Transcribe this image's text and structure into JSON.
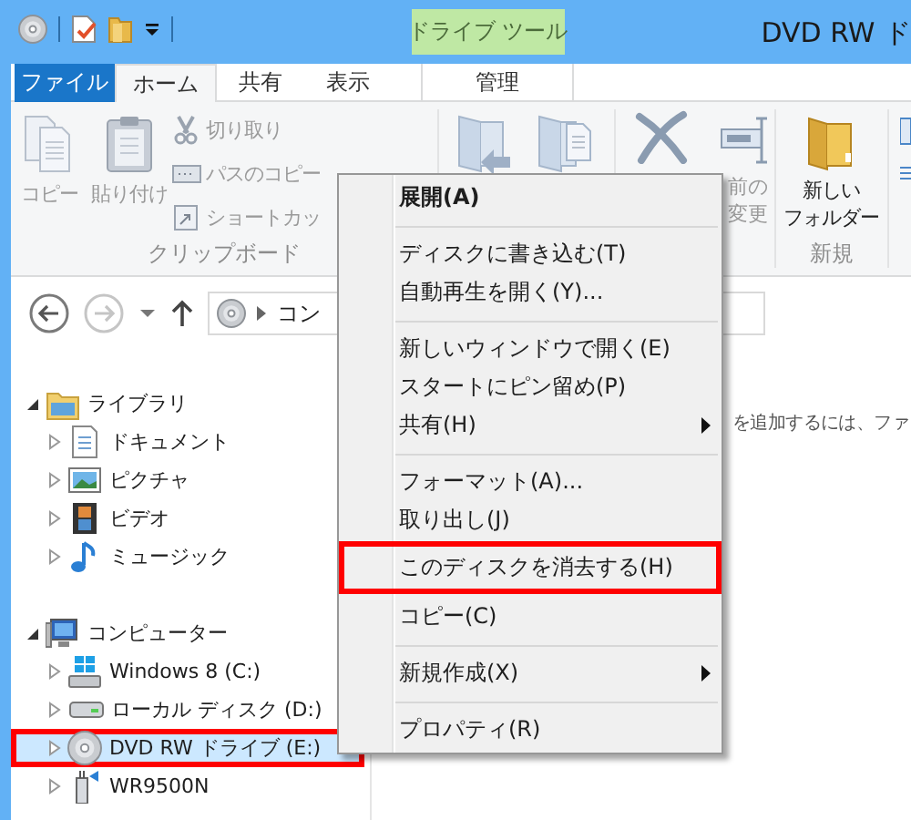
{
  "title_bar": {
    "contextual_tab": "ドライブ ツール",
    "title": "DVD RW ド"
  },
  "ribbon_tabs": [
    {
      "label": "ファイル",
      "kind": "file",
      "selected": false
    },
    {
      "label": "ホーム",
      "kind": "tab",
      "selected": true
    },
    {
      "label": "共有",
      "kind": "tab",
      "selected": false
    },
    {
      "label": "表示",
      "kind": "tab",
      "selected": false
    },
    {
      "label": "管理",
      "kind": "contextual",
      "selected": false
    }
  ],
  "ribbon": {
    "clipboard": {
      "label": "クリップボード",
      "large_buttons": [
        {
          "label": "コピー",
          "disabled": true
        },
        {
          "label": "貼り付け",
          "disabled": true
        }
      ],
      "small_buttons": [
        {
          "label": "切り取り",
          "disabled": true
        },
        {
          "label": "パスのコピー",
          "disabled": true
        },
        {
          "label": "ショートカッ",
          "disabled": true
        }
      ]
    },
    "organize": {
      "rename": {
        "label": "前の変更",
        "disabled": true
      }
    },
    "new": {
      "label": "新規",
      "new_folder": {
        "label_lines": [
          "新しい",
          "フォルダー"
        ],
        "disabled": false
      }
    }
  },
  "address_bar": {
    "crumb": "コン"
  },
  "navigation": [
    {
      "label": "ライブラリ",
      "expanded": true,
      "selected": false,
      "highlighted": false,
      "children": [
        {
          "label": "ドキュメント",
          "expanded": false,
          "selected": false,
          "highlighted": false
        },
        {
          "label": "ピクチャ",
          "expanded": false,
          "selected": false,
          "highlighted": false
        },
        {
          "label": "ビデオ",
          "expanded": false,
          "selected": false,
          "highlighted": false
        },
        {
          "label": "ミュージック",
          "expanded": false,
          "selected": false,
          "highlighted": false
        }
      ]
    },
    {
      "label": "コンピューター",
      "expanded": true,
      "selected": false,
      "highlighted": false,
      "children": [
        {
          "label": "Windows 8 (C:)",
          "expanded": false,
          "selected": false,
          "highlighted": false
        },
        {
          "label": "ローカル ディスク (D:)",
          "expanded": false,
          "selected": false,
          "highlighted": false
        },
        {
          "label": "DVD RW ドライブ (E:)",
          "expanded": false,
          "selected": true,
          "highlighted": true
        },
        {
          "label": "WR9500N",
          "expanded": false,
          "selected": false,
          "highlighted": false
        }
      ]
    }
  ],
  "content": {
    "hint": "を追加するには、ファ"
  },
  "context_menu": {
    "items": [
      {
        "kind": "item",
        "label": "展開(A)",
        "default": true,
        "submenu": false,
        "highlighted": false
      },
      {
        "kind": "separator"
      },
      {
        "kind": "item",
        "label": "ディスクに書き込む(T)",
        "default": false,
        "submenu": false,
        "highlighted": false
      },
      {
        "kind": "item",
        "label": "自動再生を開く(Y)...",
        "default": false,
        "submenu": false,
        "highlighted": false
      },
      {
        "kind": "separator"
      },
      {
        "kind": "item",
        "label": "新しいウィンドウで開く(E)",
        "default": false,
        "submenu": false,
        "highlighted": false
      },
      {
        "kind": "item",
        "label": "スタートにピン留め(P)",
        "default": false,
        "submenu": false,
        "highlighted": false
      },
      {
        "kind": "item",
        "label": "共有(H)",
        "default": false,
        "submenu": true,
        "highlighted": false
      },
      {
        "kind": "separator"
      },
      {
        "kind": "item",
        "label": "フォーマット(A)...",
        "default": false,
        "submenu": false,
        "highlighted": false
      },
      {
        "kind": "item",
        "label": "取り出し(J)",
        "default": false,
        "submenu": false,
        "highlighted": false
      },
      {
        "kind": "item",
        "label": "このディスクを消去する(H)",
        "default": false,
        "submenu": false,
        "highlighted": true
      },
      {
        "kind": "item",
        "label": "コピー(C)",
        "default": false,
        "submenu": false,
        "highlighted": false
      },
      {
        "kind": "separator"
      },
      {
        "kind": "item",
        "label": "新規作成(X)",
        "default": false,
        "submenu": true,
        "highlighted": false
      },
      {
        "kind": "separator"
      },
      {
        "kind": "item",
        "label": "プロパティ(R)",
        "default": false,
        "submenu": false,
        "highlighted": false
      }
    ]
  }
}
